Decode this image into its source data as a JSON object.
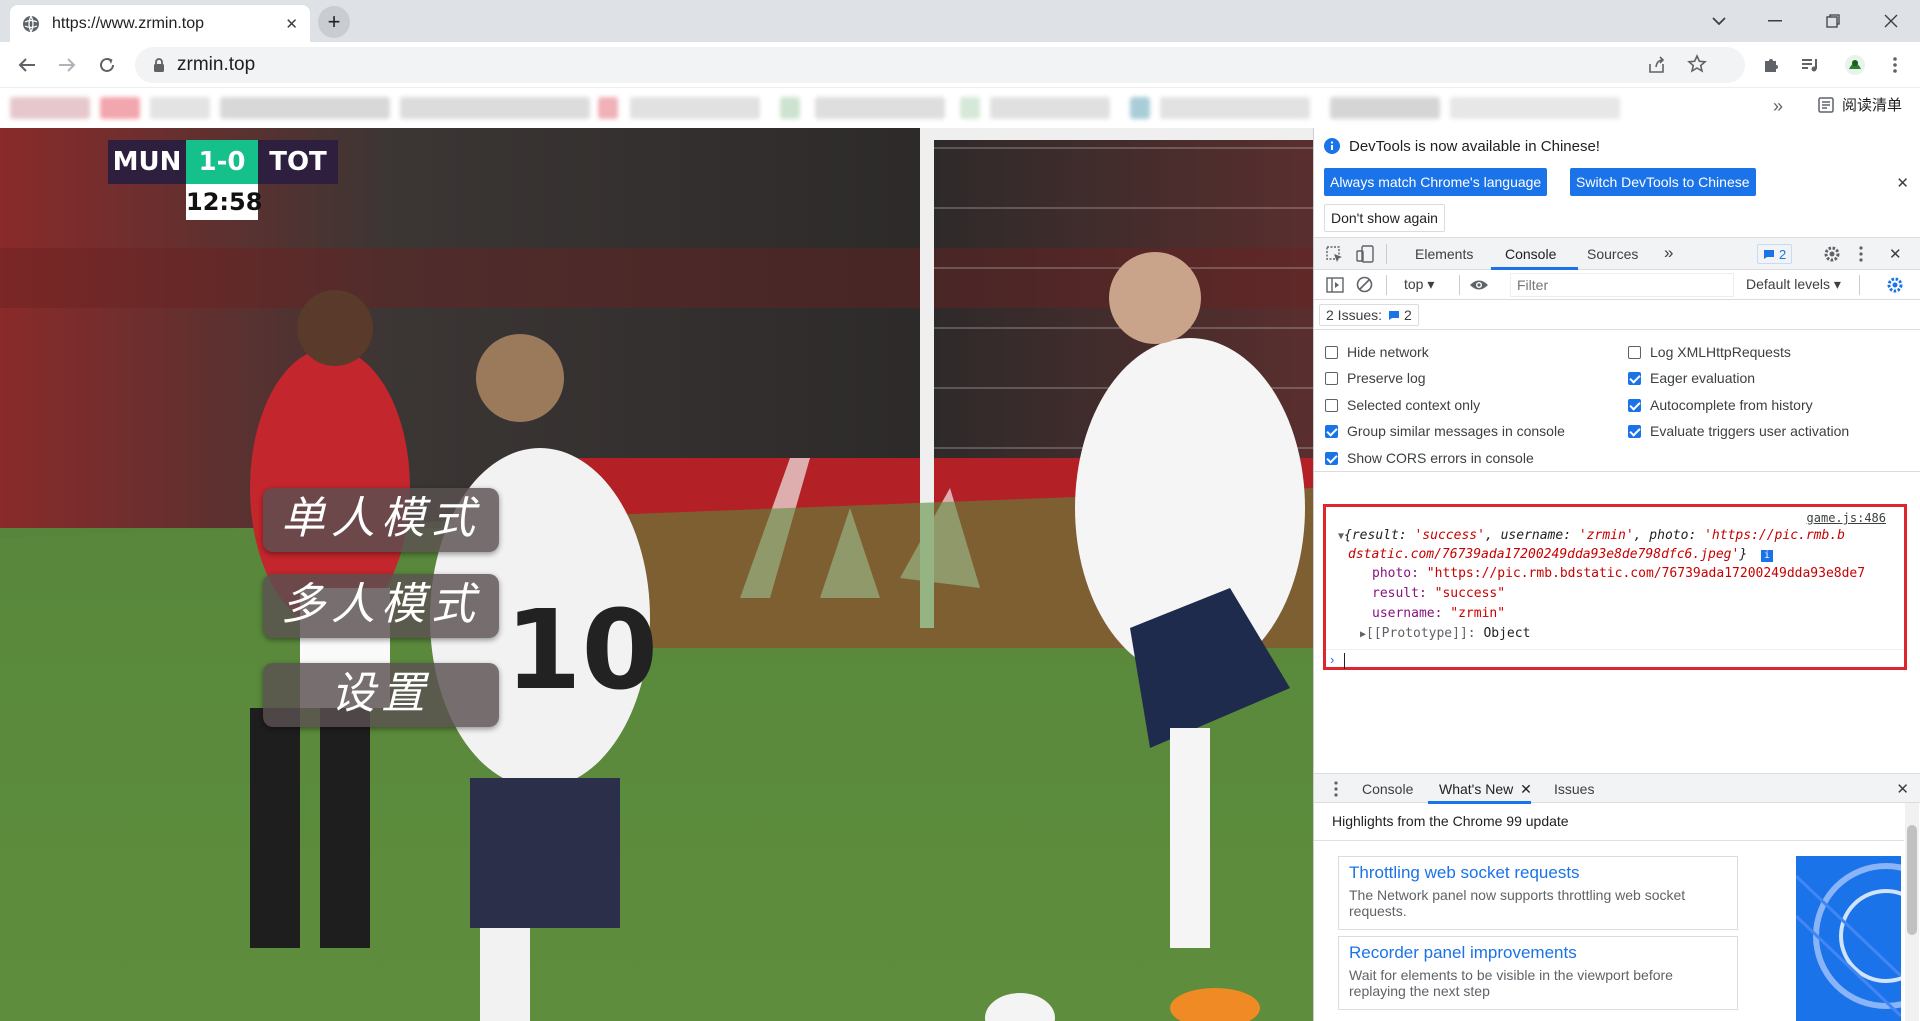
{
  "browser": {
    "tab_title": "https://www.zrmin.top",
    "new_tab_label": "+",
    "address": "zrmin.top",
    "reading_list": "阅读清单",
    "bookmarks_overflow": "»"
  },
  "page": {
    "scoreboard": {
      "home": "MUN",
      "score": "1-0",
      "away": "TOT",
      "clock": "12:58"
    },
    "menu": {
      "single": "单人模式",
      "multi": "多人模式",
      "settings": "设置"
    }
  },
  "devtools": {
    "banner": {
      "message": "DevTools is now available in Chinese!",
      "match_language": "Always match Chrome's language",
      "switch_chinese": "Switch DevTools to Chinese",
      "dont_show": "Don't show again"
    },
    "tabs": {
      "elements": "Elements",
      "console": "Console",
      "sources": "Sources",
      "more": "»",
      "issues_count": "2"
    },
    "console_toolbar": {
      "context": "top",
      "filter_placeholder": "Filter",
      "levels": "Default levels"
    },
    "issues_bar": {
      "label": "2 Issues:",
      "count": "2"
    },
    "settings": {
      "hide_network": "Hide network",
      "preserve_log": "Preserve log",
      "selected_context": "Selected context only",
      "group_similar": "Group similar messages in console",
      "show_cors": "Show CORS errors in console",
      "log_xhr": "Log XMLHttpRequests",
      "eager_eval": "Eager evaluation",
      "autocomplete": "Autocomplete from history",
      "evaluate_triggers": "Evaluate triggers user activation"
    },
    "log": {
      "source": "game.js:486",
      "summary_line1_prefix": "{result: ",
      "summary_result": "'success'",
      "summary_username_key": ", username: ",
      "summary_username": "'zrmin'",
      "summary_photo_key": ", photo: ",
      "summary_photo_a": "'https://pic.rmb.b",
      "summary_photo_b": "dstatic.com/76739ada17200249dda93e8de798dfc6.jpeg'",
      "summary_close": "}",
      "photo_key": "photo:",
      "photo_val": "\"https://pic.rmb.bdstatic.com/76739ada17200249dda93e8de7",
      "result_key": "result:",
      "result_val": "\"success\"",
      "username_key": "username:",
      "username_val": "\"zrmin\"",
      "proto_key": "[[Prototype]]:",
      "proto_val": "Object"
    },
    "drawer": {
      "tab_console": "Console",
      "tab_whatsnew": "What's New",
      "tab_issues": "Issues",
      "highlights": "Highlights from the Chrome 99 update",
      "card1_title": "Throttling web socket requests",
      "card1_desc": "The Network panel now supports throttling web socket requests.",
      "card2_title": "Recorder panel improvements",
      "card2_desc": "Wait for elements to be visible in the viewport before replaying the next step"
    }
  }
}
